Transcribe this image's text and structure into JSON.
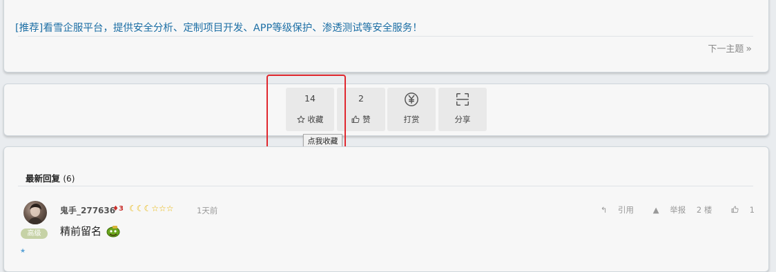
{
  "post": {
    "promo_text": "[推荐]看雪企服平台，提供安全分析、定制项目开发、APP等级保护、渗透测试等安全服务！",
    "next_topic": "下一主题",
    "next_chevron": "»"
  },
  "actions": {
    "favorite": {
      "count": "14",
      "label": "收藏",
      "icon": "star-outline-icon"
    },
    "like": {
      "count": "2",
      "label": "赞",
      "icon": "thumb-up-icon"
    },
    "reward": {
      "label": "打赏",
      "icon": "yen-circle-icon"
    },
    "share": {
      "label": "分享",
      "icon": "scan-frame-icon"
    },
    "tooltip": "点我收藏"
  },
  "replies": {
    "title": "最新回复",
    "count": "(6)",
    "items": [
      {
        "username": "鬼手_277636",
        "gem_level": "3",
        "rank_icons": "☾☾☾☆☆☆",
        "time": "1天前",
        "level_badge": "高级",
        "quote_label": "引用",
        "report_label": "举报",
        "floor": "2 楼",
        "likes": "1",
        "content": "精前留名"
      }
    ]
  },
  "colors": {
    "accent_link": "#1d6fa5",
    "highlight_border": "#e0262d",
    "level_badge_bg": "#c6d2a6",
    "gem": "#c9302c",
    "rank_gold": "#e8b400"
  }
}
